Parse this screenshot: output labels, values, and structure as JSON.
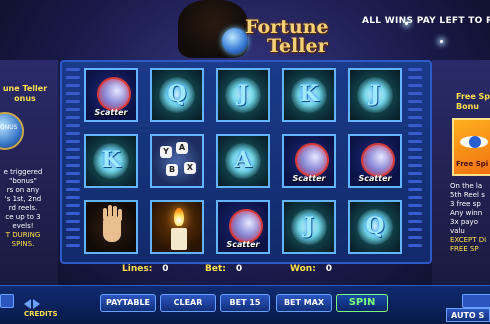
{
  "header": {
    "title_line1": "Fortune",
    "title_line2": "Teller",
    "wins_text": "ALL WINS PAY LEFT TO R"
  },
  "left_panel": {
    "title_line1": "une Teller",
    "title_line2": "onus",
    "orb_label": "ONUS",
    "text_lines": [
      "e triggered",
      "\"bonus\"",
      "rs on any",
      "'s 1st, 2nd",
      "rd reels.",
      "ce up to 3",
      "evels!"
    ],
    "yellow_lines": [
      "T DURING",
      "SPINS."
    ]
  },
  "right_panel": {
    "title_line1": "Free Sp",
    "title_line2": "Bonu",
    "eye_label": "Free Spi",
    "text_lines": [
      "On the la",
      "5th Reel s",
      "3 free sp",
      "Any winn",
      "3x payo",
      "valu"
    ],
    "yellow_lines": [
      "EXCEPT DI",
      "FREE SP"
    ]
  },
  "reels": [
    [
      {
        "type": "scatter",
        "label": "Scatter"
      },
      {
        "type": "letter",
        "symbol": "Q"
      },
      {
        "type": "letter",
        "symbol": "J"
      },
      {
        "type": "letter",
        "symbol": "K"
      },
      {
        "type": "letter",
        "symbol": "J"
      }
    ],
    [
      {
        "type": "letter",
        "symbol": "K"
      },
      {
        "type": "dice",
        "symbol": "dice",
        "faces": [
          "Y",
          "A",
          "B",
          "X"
        ]
      },
      {
        "type": "letter",
        "symbol": "A"
      },
      {
        "type": "scatter",
        "label": "Scatter"
      },
      {
        "type": "scatter",
        "label": "Scatter"
      }
    ],
    [
      {
        "type": "hand",
        "symbol": "palm"
      },
      {
        "type": "candle",
        "symbol": "candle"
      },
      {
        "type": "scatter",
        "label": "Scatter"
      },
      {
        "type": "letter",
        "symbol": "J"
      },
      {
        "type": "letter",
        "symbol": "Q"
      }
    ]
  ],
  "status": {
    "lines_label": "Lines:",
    "lines_value": "0",
    "bet_label": "Bet:",
    "bet_value": "0",
    "won_label": "Won:",
    "won_value": "0"
  },
  "controls": {
    "paytable": "PAYTABLE",
    "clear": "CLEAR",
    "bet15": "BET 15",
    "betmax": "BET MAX",
    "spin": "SPIN",
    "credits_label": "CREDITS",
    "auto_label": "AUTO S"
  },
  "colors": {
    "accent_yellow": "#ffe14a",
    "spin_green": "#7dff7a",
    "reel_border": "#62b4ff"
  }
}
